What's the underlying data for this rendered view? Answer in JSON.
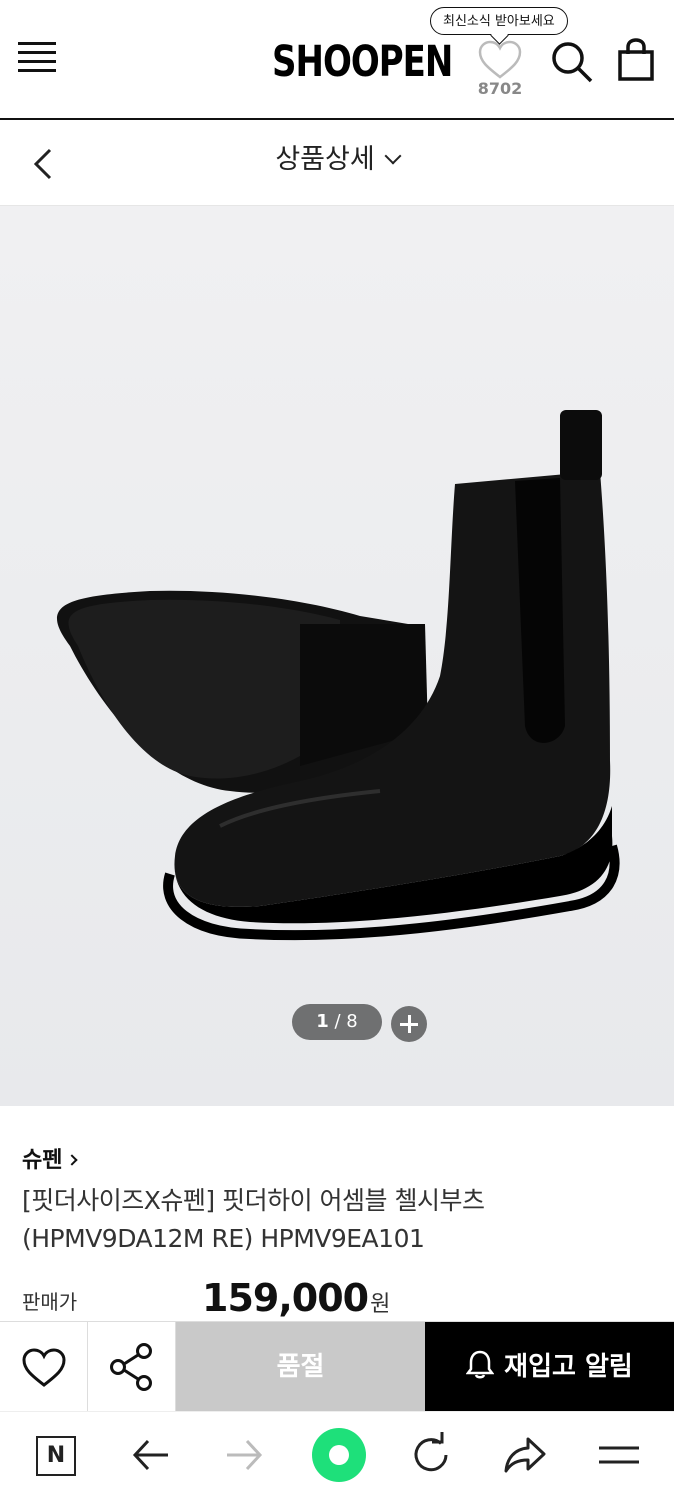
{
  "header": {
    "logo_text": "SHOOPEN",
    "tooltip": "최신소식 받아보세요",
    "wish_count": "8702"
  },
  "subheader": {
    "title": "상품상세"
  },
  "gallery": {
    "current": "1",
    "total": "8",
    "separator": " / "
  },
  "product": {
    "brand": "슈펜",
    "name_line1": "[핏더사이즈X슈펜] 핏더하이 어셈블 첼시부츠",
    "name_line2": "(HPMV9DA12M RE) HPMV9EA101",
    "price_label": "판매가",
    "price": "159,000",
    "price_unit": "원"
  },
  "actions": {
    "soldout_label": "품절",
    "restock_label": "재입고 알림"
  },
  "colors": {
    "accent_green": "#1ee07a",
    "restock_bg": "#000000",
    "soldout_bg": "#c9c9c9"
  }
}
